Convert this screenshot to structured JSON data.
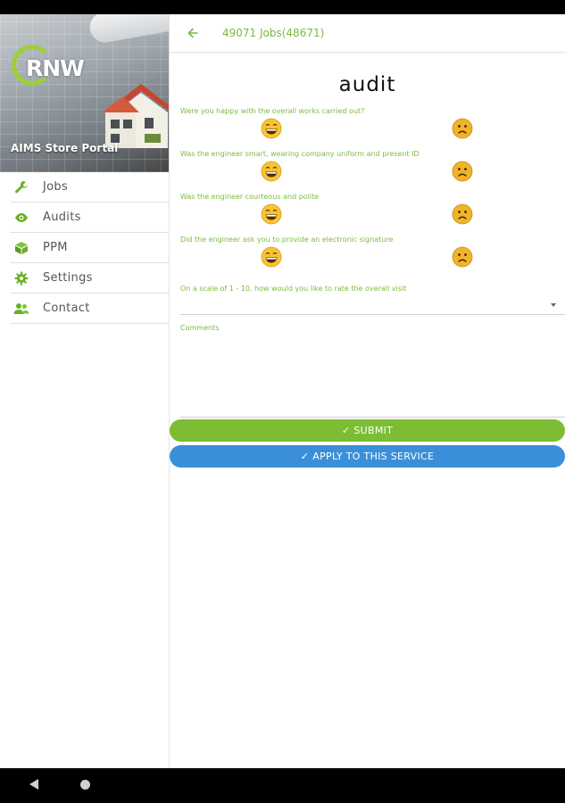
{
  "sidebar": {
    "brand": "RNW",
    "portal_title": "AIMS Store Portal",
    "items": [
      {
        "label": "Jobs",
        "icon": "wrench-icon"
      },
      {
        "label": "Audits",
        "icon": "eye-icon"
      },
      {
        "label": "PPM",
        "icon": "cube-icon"
      },
      {
        "label": "Settings",
        "icon": "gear-icon"
      },
      {
        "label": "Contact",
        "icon": "contacts-icon"
      }
    ]
  },
  "topbar": {
    "title": "49071 Jobs(48671)",
    "back_icon": "arrow-left-icon"
  },
  "form": {
    "title": "audit",
    "questions": [
      {
        "text": "Were you happy with the overall works carried out?"
      },
      {
        "text": "Was the engineer smart, wearing company uniform and present ID"
      },
      {
        "text": "Was the engineer courteous and polite"
      },
      {
        "text": "Did the engineer ask you to provide an electronic signature"
      }
    ],
    "rating_label": "On a scale of 1 - 10, how would you like to rate the overall visit",
    "rating_value": "",
    "comments_label": "Comments",
    "comments_value": ""
  },
  "buttons": {
    "submit_label": "SUBMIT",
    "apply_label": "APPLY TO THIS SERVICE"
  },
  "colors": {
    "accent_green": "#7cbd34",
    "accent_blue": "#3b8fd8",
    "text_green": "#7dbb3c"
  }
}
